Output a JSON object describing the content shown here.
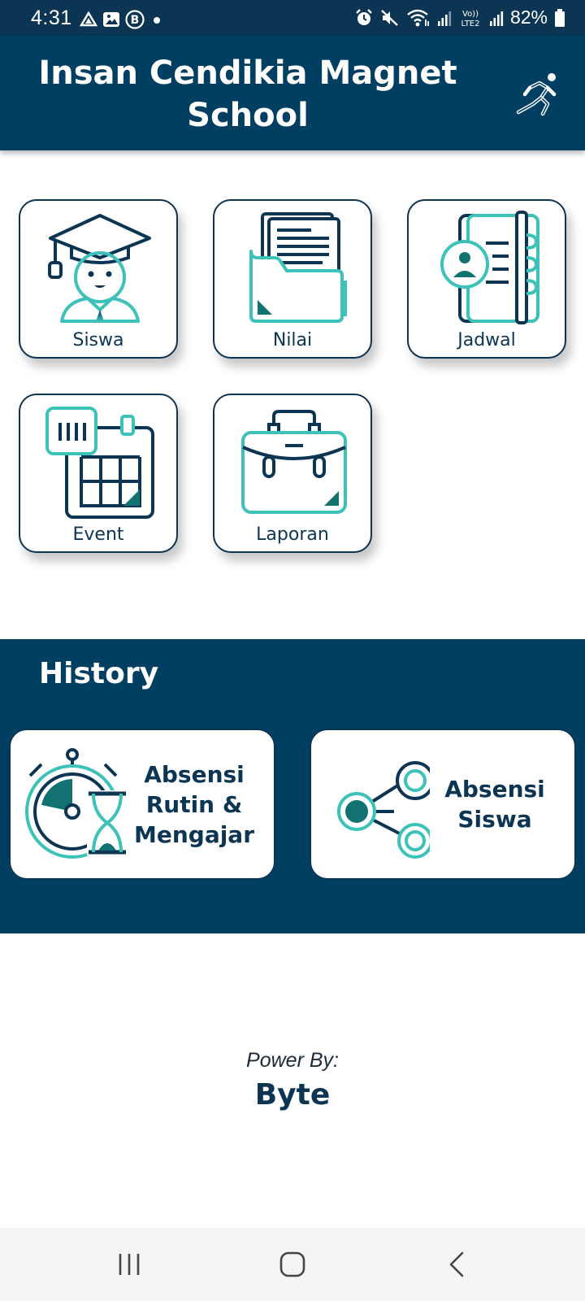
{
  "status_bar": {
    "time": "4:31",
    "battery_percent": "82%",
    "left_icons": [
      "drive-icon",
      "image-icon",
      "b-badge-icon",
      "dot-icon"
    ],
    "right_icons": [
      "alarm-icon",
      "mute-icon",
      "wifi-icon",
      "signal-icon",
      "volte-icon",
      "signal-icon",
      "battery-icon"
    ],
    "volte_label": "Vo)) LTE2"
  },
  "header": {
    "title": "Insan Cendikia Magnet School",
    "action_icon": "running-man-icon"
  },
  "menu": {
    "items": [
      {
        "label": "Siswa",
        "icon": "graduate-student-icon"
      },
      {
        "label": "Nilai",
        "icon": "document-folder-icon"
      },
      {
        "label": "Jadwal",
        "icon": "schedule-notebook-icon"
      },
      {
        "label": "Event",
        "icon": "calendar-event-icon"
      },
      {
        "label": "Laporan",
        "icon": "briefcase-icon"
      }
    ]
  },
  "history": {
    "title": "History",
    "cards": [
      {
        "label": "Absensi Rutin & Mengajar",
        "icon": "stopwatch-hourglass-icon"
      },
      {
        "label": "Absensi Siswa",
        "icon": "network-nodes-icon"
      }
    ]
  },
  "footer": {
    "powered_by": "Power By:",
    "brand": "Byte"
  },
  "nav": {
    "icons": [
      "recent-apps-icon",
      "home-icon",
      "back-icon"
    ]
  },
  "colors": {
    "primary": "#013f62",
    "dark_text": "#0c3553",
    "teal": "#3cc2b8",
    "teal_dark": "#12726f"
  }
}
